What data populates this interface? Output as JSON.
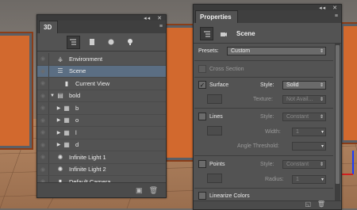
{
  "panel_3d": {
    "collapse_glyph": "◂◂",
    "close_glyph": "✕",
    "tab_label": "3D",
    "menu_glyph": "≡",
    "filter_icons": [
      "scene-filter-icon",
      "mesh-filter-icon",
      "material-filter-icon",
      "light-filter-icon"
    ],
    "rows": [
      {
        "label": "Environment",
        "indent": 0,
        "expand": "",
        "icon": "environment-icon",
        "selected": false
      },
      {
        "label": "Scene",
        "indent": 0,
        "expand": "",
        "icon": "scene-icon",
        "selected": true
      },
      {
        "label": "Current View",
        "indent": 1,
        "expand": "",
        "icon": "camera-icon",
        "selected": false
      },
      {
        "label": "bold",
        "indent": 0,
        "expand": "▼",
        "icon": "group-icon",
        "selected": false
      },
      {
        "label": "b",
        "indent": 1,
        "expand": "▶",
        "icon": "mesh-icon",
        "selected": false
      },
      {
        "label": "o",
        "indent": 1,
        "expand": "▶",
        "icon": "mesh-icon",
        "selected": false
      },
      {
        "label": "l",
        "indent": 1,
        "expand": "▶",
        "icon": "mesh-icon",
        "selected": false
      },
      {
        "label": "d",
        "indent": 1,
        "expand": "▶",
        "icon": "mesh-icon",
        "selected": false
      },
      {
        "label": "Infinite Light 1",
        "indent": 0,
        "expand": "",
        "icon": "light-icon",
        "selected": false
      },
      {
        "label": "Infinite Light 2",
        "indent": 0,
        "expand": "",
        "icon": "light-icon",
        "selected": false
      },
      {
        "label": "Default Camera",
        "indent": 0,
        "expand": "",
        "icon": "camera-icon",
        "selected": false
      }
    ]
  },
  "panel_properties": {
    "collapse_glyph": "◂◂",
    "close_glyph": "✕",
    "tab_label": "Properties",
    "menu_glyph": "≡",
    "header_label": "Scene",
    "presets_label": "Presets:",
    "presets_value": "Custom",
    "cross_section_label": "Cross Section",
    "surface_label": "Surface",
    "surface_style_label": "Style:",
    "surface_style_value": "Solid",
    "texture_label": "Texture:",
    "texture_value": "Not Avail...",
    "lines_label": "Lines",
    "lines_style_label": "Style:",
    "lines_style_value": "Constant",
    "width_label": "Width:",
    "width_value": "1",
    "angle_label": "Angle Threshold:",
    "points_label": "Points",
    "points_style_label": "Style:",
    "points_style_value": "Constant",
    "radius_label": "Radius:",
    "radius_value": "1",
    "linearize_label": "Linearize Colors",
    "check_glyph": "✓"
  }
}
